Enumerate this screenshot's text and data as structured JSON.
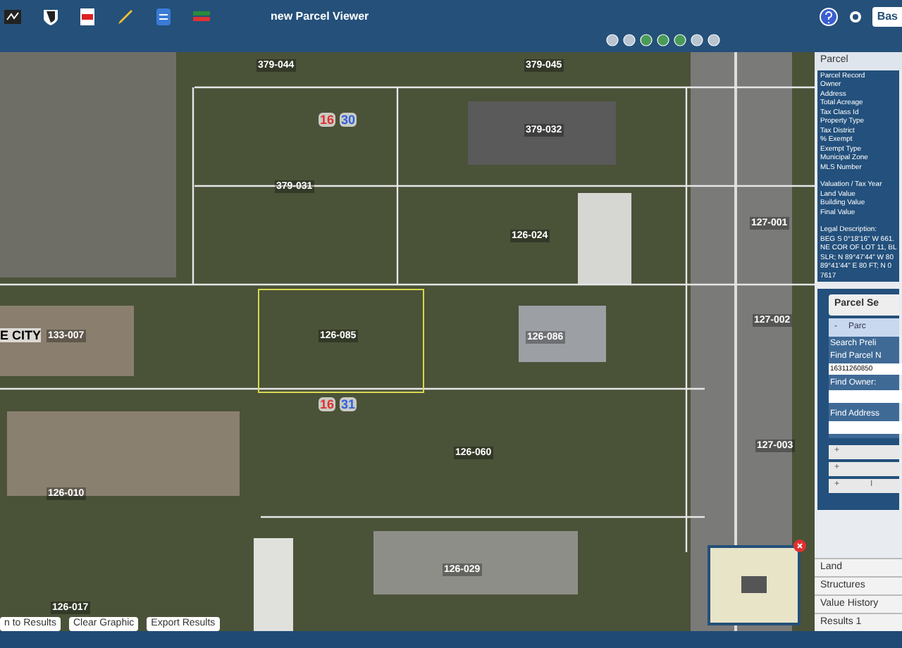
{
  "window": {
    "title": "new Parcel Viewer"
  },
  "header": {
    "basemap_button": "Bas"
  },
  "map": {
    "parcel_labels": [
      {
        "text": "379-044",
        "selected": false
      },
      {
        "text": "379-045",
        "selected": false
      },
      {
        "text": "379-032",
        "selected": false
      },
      {
        "text": "379-031",
        "selected": false
      },
      {
        "text": "127-001",
        "selected": false
      },
      {
        "text": "126-024",
        "selected": false
      },
      {
        "text": "127-002",
        "selected": false
      },
      {
        "text": "133-007",
        "selected": false
      },
      {
        "text": "126-085",
        "selected": true
      },
      {
        "text": "126-086",
        "selected": false
      },
      {
        "text": "127-003",
        "selected": false
      },
      {
        "text": "126-060",
        "selected": false
      },
      {
        "text": "126-010",
        "selected": false
      },
      {
        "text": "126-029",
        "selected": false
      },
      {
        "text": "126-017",
        "selected": false
      }
    ],
    "lot_labels": [
      {
        "block": "16",
        "lot": "30"
      },
      {
        "block": "16",
        "lot": "31"
      }
    ],
    "place_label": "E CITY",
    "buttons": [
      "n to Results",
      "Clear Graphic",
      "Export Results"
    ]
  },
  "panel": {
    "title": "Parcel",
    "fields": [
      "Parcel Record",
      "Owner",
      "Address",
      "Total Acreage",
      "Tax Class Id",
      "Property Type",
      "Tax District",
      "% Exempt",
      "Exempt Type",
      "Municipal Zone",
      "MLS Number"
    ],
    "valuation": [
      "Valuation / Tax Year",
      "Land Value",
      "Building Value",
      "Final Value"
    ],
    "legal": [
      "Legal Description:",
      "BEG S 0°18'16\" W 661.",
      "NE COR OF LOT 11, BL",
      "SLR; N 89°47'44\" W 80",
      "89°41'44\" E 80 FT; N 0",
      "7617"
    ],
    "search_button": "Parcel Se",
    "section": {
      "toggle": "-",
      "title": "Parc",
      "expanded": true
    },
    "search_title": "Search Preli",
    "find_parcel": {
      "label": "Find Parcel N",
      "value": "16311260850"
    },
    "find_owner": {
      "label": "Find Owner:"
    },
    "find_address": {
      "label": "Find Address"
    },
    "collapsed_sections": [
      {
        "toggle": "+"
      },
      {
        "toggle": "+"
      },
      {
        "toggle": "+",
        "title": "I"
      }
    ],
    "tabs": [
      {
        "label": "Land",
        "selected": false
      },
      {
        "label": "Structures",
        "selected": false
      },
      {
        "label": "Value History",
        "selected": false
      },
      {
        "label": "Results 1",
        "selected": false
      }
    ]
  }
}
